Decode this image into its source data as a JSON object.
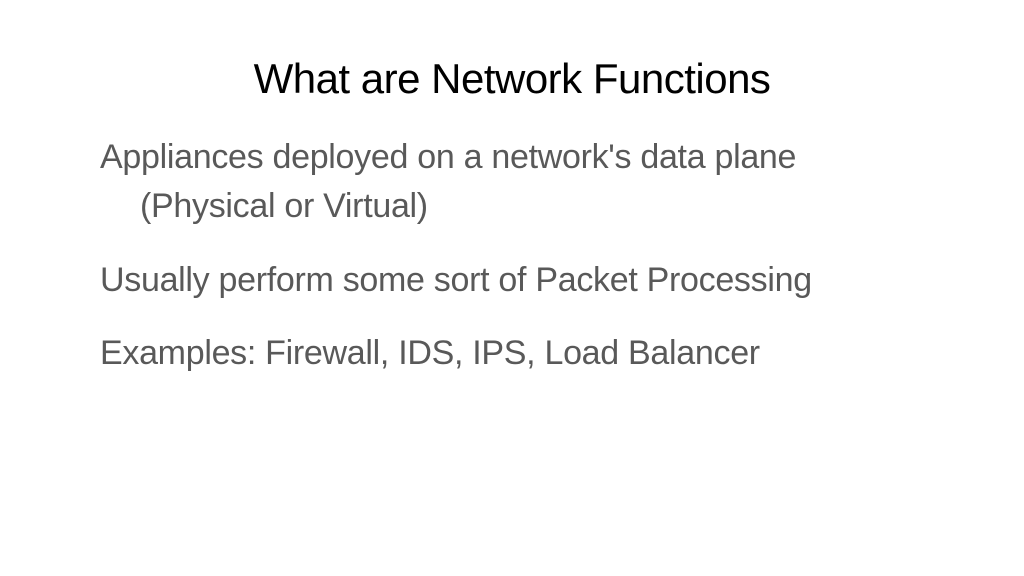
{
  "slide": {
    "title": "What are Network Functions",
    "point1_line1": "Appliances deployed on a network's data plane",
    "point1_line2": "(Physical or Virtual)",
    "point2": "Usually perform some sort of Packet Processing",
    "point3": "Examples: Firewall, IDS, IPS, Load Balancer"
  }
}
